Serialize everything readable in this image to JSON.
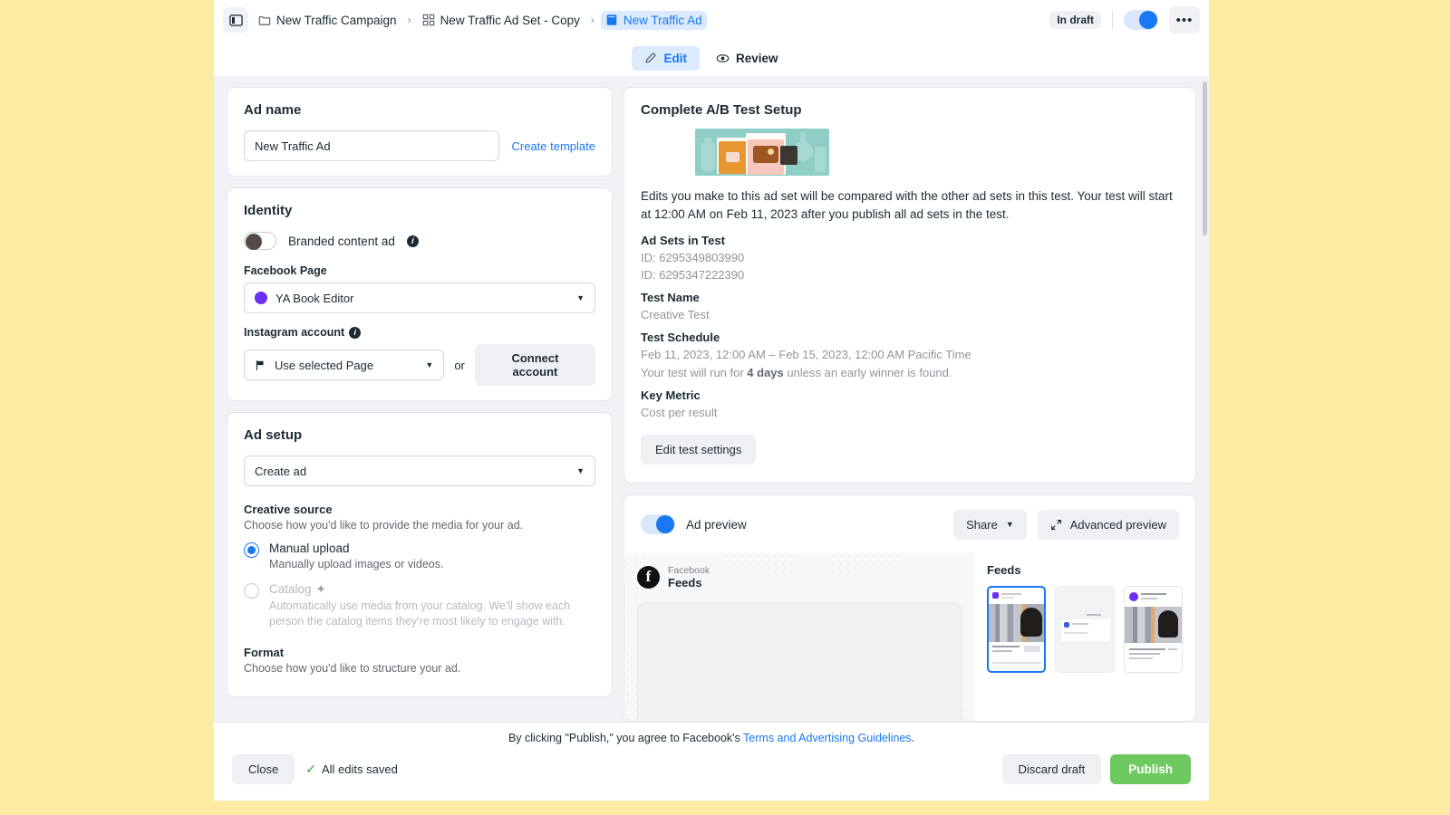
{
  "topbar": {
    "panel_toggle_icon": "sidebar-toggle-icon",
    "breadcrumbs": [
      {
        "label": "New Traffic Campaign",
        "icon": "folder-icon",
        "active": false
      },
      {
        "label": "New Traffic Ad Set - Copy",
        "icon": "grid-icon",
        "active": false
      },
      {
        "label": "New Traffic Ad",
        "icon": "ad-icon",
        "active": true
      }
    ],
    "status_badge": "In draft",
    "more_label": "•••"
  },
  "tabs": [
    {
      "label": "Edit",
      "icon": "pencil-icon",
      "active": true
    },
    {
      "label": "Review",
      "icon": "eye-icon",
      "active": false
    }
  ],
  "ad_name": {
    "title": "Ad name",
    "value": "New Traffic Ad",
    "placeholder": "New Traffic Ad",
    "create_template": "Create template"
  },
  "identity": {
    "title": "Identity",
    "branded_toggle_label": "Branded content ad",
    "facebook_page_label": "Facebook Page",
    "facebook_page_value": "YA Book Editor",
    "instagram_label": "Instagram account",
    "instagram_value": "Use selected Page",
    "or_label": "or",
    "connect_account": "Connect account"
  },
  "ad_setup": {
    "title": "Ad setup",
    "setup_value": "Create ad",
    "creative_source_title": "Creative source",
    "creative_source_desc": "Choose how you'd like to provide the media for your ad.",
    "options": [
      {
        "label": "Manual upload",
        "desc": "Manually upload images or videos.",
        "selected": true,
        "disabled": false
      },
      {
        "label": "Catalog",
        "badge_icon": "sparkle-icon",
        "desc": "Automatically use media from your catalog. We'll show each person the catalog items they're most likely to engage with.",
        "selected": false,
        "disabled": true
      }
    ],
    "format_title": "Format",
    "format_desc": "Choose how you'd like to structure your ad."
  },
  "ab_test": {
    "title": "Complete A/B Test Setup",
    "illustration": "ab-test-illustration",
    "description": "Edits you make to this ad set will be compared with the other ad sets in this test. Your test will start at 12:00 AM on Feb 11, 2023 after you publish all ad sets in the test.",
    "sections": [
      {
        "heading": "Ad Sets in Test",
        "lines": [
          "ID: 6295349803990",
          "ID: 6295347222390"
        ]
      },
      {
        "heading": "Test Name",
        "lines": [
          "Creative Test"
        ]
      },
      {
        "heading": "Test Schedule",
        "lines": [
          "Feb 11, 2023, 12:00 AM – Feb 15, 2023, 12:00 AM Pacific Time"
        ]
      },
      {
        "heading": "Key Metric",
        "lines": [
          "Cost per result"
        ]
      }
    ],
    "run_prefix": "Your test will run for ",
    "run_bold": "4 days",
    "run_suffix": " unless an early winner is found.",
    "edit_button": "Edit test settings"
  },
  "ad_preview": {
    "toggle_label": "Ad preview",
    "share_label": "Share",
    "advanced_label": "Advanced preview",
    "advanced_icon": "expand-icon",
    "platform_kicker": "Facebook",
    "platform_title": "Feeds",
    "thumbs_title": "Feeds",
    "thumbs": [
      {
        "name": "facebook-feed-thumb",
        "selected": true
      },
      {
        "name": "instagram-feed-thumb",
        "selected": false
      },
      {
        "name": "marketplace-thumb",
        "selected": false
      }
    ]
  },
  "footer": {
    "terms_prefix": "By clicking \"Publish,\" you agree to Facebook's ",
    "terms_link": "Terms and Advertising Guidelines",
    "terms_suffix": ".",
    "close_label": "Close",
    "saved_label": "All edits saved",
    "discard_label": "Discard draft",
    "publish_label": "Publish"
  },
  "colors": {
    "brand_blue": "#1877f2",
    "publish_green": "#6ec960",
    "page_yellow": "#fdeba4",
    "page_avatar_purple": "#6b2ff5",
    "illustration_teal": "#8fcec6"
  }
}
